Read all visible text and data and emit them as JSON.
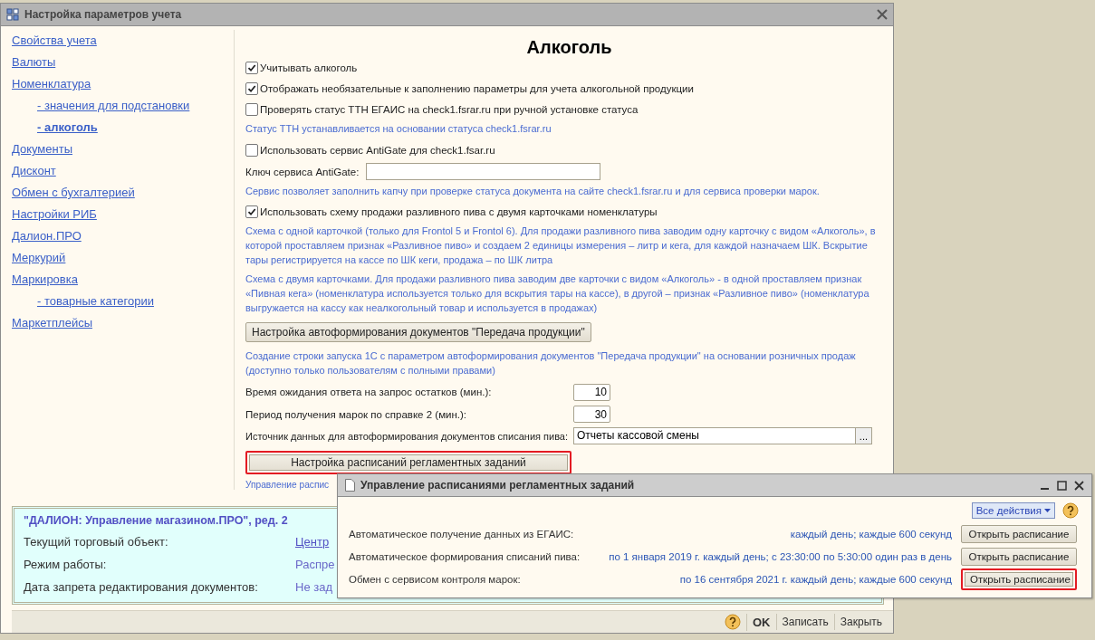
{
  "window": {
    "title": "Настройка параметров учета"
  },
  "sidebar": {
    "items": [
      {
        "label": "Свойства учета",
        "selected": false
      },
      {
        "label": "Валюты",
        "selected": false
      },
      {
        "label": "Номенклатура",
        "selected": false,
        "children": [
          {
            "label": "- значения для подстановки",
            "selected": false
          },
          {
            "label": "- алкоголь",
            "selected": true
          }
        ]
      },
      {
        "label": "Документы",
        "selected": false
      },
      {
        "label": "Дисконт",
        "selected": false
      },
      {
        "label": "Обмен с бухгалтерией",
        "selected": false
      },
      {
        "label": "Настройки РИБ",
        "selected": false
      },
      {
        "label": "Далион.ПРО",
        "selected": false
      },
      {
        "label": "Меркурий",
        "selected": false
      },
      {
        "label": "Маркировка",
        "selected": false,
        "children": [
          {
            "label": "- товарные категории",
            "selected": false
          }
        ]
      },
      {
        "label": "Маркетплейсы",
        "selected": false
      }
    ]
  },
  "content": {
    "heading": "Алкоголь",
    "items": [
      {
        "kind": "checkbox",
        "label": "Учитывать алкоголь",
        "checked": true
      },
      {
        "kind": "checkbox",
        "label": "Отображать необязательные к заполнению параметры для учета алкогольной продукции",
        "checked": true
      },
      {
        "kind": "checkbox",
        "label": "Проверять статус ТТН ЕГАИС на check1.fsrar.ru при ручной установке статуса",
        "checked": false
      },
      {
        "kind": "note",
        "text": "Статус ТТН устанавливается на основании статуса check1.fsrar.ru"
      },
      {
        "kind": "checkbox",
        "label": "Использовать сервис AntiGate для check1.fsar.ru",
        "checked": false
      },
      {
        "kind": "text_field",
        "label": "Ключ сервиса AntiGate:"
      },
      {
        "kind": "note",
        "text": "Сервис позволяет заполнить капчу при проверке статуса документа на сайте check1.fsrar.ru и для сервиса проверки марок."
      },
      {
        "kind": "checkbox",
        "label": "Использовать схему продажи разливного пива с двумя карточками номенклатуры",
        "checked": true
      },
      {
        "kind": "note",
        "text": "Схема с одной карточкой (только для Frontol 5 и Frontol 6). Для продажи разливного пива заводим одну карточку с видом «Алкоголь», в которой проставляем признак «Разливное пиво» и создаем 2 единицы измерения – литр и кега, для каждой назначаем ШК. Вскрытие тары регистрируется на кассе по ШК кеги, продажа – по ШК литра"
      },
      {
        "kind": "note",
        "text": "Схема с двумя карточками. Для продажи разливного пива заводим две карточки с видом «Алкоголь» - в одной проставляем признак «Пивная кега» (номенклатура используется только для вскрытия тары на кассе), в другой – признак «Разливное пиво» (номенклатура выгружается на кассу как неалкогольный товар и используется в продажах)"
      },
      {
        "kind": "button",
        "label": "Настройка автоформирования документов \"Передача продукции\"",
        "highlighted": false
      },
      {
        "kind": "note",
        "text": "Создание строки запуска 1С с параметром автоформирования документов \"Передача продукции\" на основании розничных продаж (доступно только пользователям с полными правами)"
      },
      {
        "kind": "number_field",
        "label": "Время ожидания ответа на запрос остатков (мин.):",
        "value": "10"
      },
      {
        "kind": "number_field",
        "label": "Период получения марок по справке 2 (мин.):",
        "value": "30"
      },
      {
        "kind": "select_field",
        "label": "Источник данных для автоформирования документов списания пива:",
        "value": "Отчеты кассовой смены",
        "button": "..."
      },
      {
        "kind": "button",
        "label": "Настройка расписаний регламентных заданий",
        "highlighted": true
      },
      {
        "kind": "link",
        "text": "Управление распис"
      }
    ]
  },
  "info_panel": {
    "title": "\"ДАЛИОН: Управление магазином.ПРО\", ред. 2",
    "rows": [
      {
        "label": "Текущий торговый объект:",
        "value": "Центр",
        "kind": "link"
      },
      {
        "label": "Режим работы:",
        "value": "Распре",
        "kind": "text"
      },
      {
        "label": "Дата запрета редактирования документов:",
        "value": "Не зад",
        "kind": "text"
      }
    ]
  },
  "footer": {
    "buttons": [
      {
        "label": "OK",
        "kind": "default"
      },
      {
        "label": "Записать",
        "kind": "plain"
      },
      {
        "label": "Закрыть",
        "kind": "plain"
      }
    ]
  },
  "dialog": {
    "title": "Управление расписаниями регламентных заданий",
    "actions_button": "Все действия",
    "rows": [
      {
        "label": "Автоматическое получение данных из ЕГАИС:",
        "schedule": "каждый день; каждые 600 секунд",
        "button": "Открыть расписание",
        "highlighted": false
      },
      {
        "label": "Автоматическое формирования списаний пива:",
        "schedule": "по 1 января 2019 г. каждый день; с 23:30:00 по 5:30:00 один раз в день",
        "button": "Открыть расписание",
        "highlighted": false
      },
      {
        "label": "Обмен с сервисом контроля марок:",
        "schedule": "по 16 сентября 2021 г. каждый день; каждые 600 секунд",
        "button": "Открыть расписание",
        "highlighted": true
      }
    ]
  }
}
